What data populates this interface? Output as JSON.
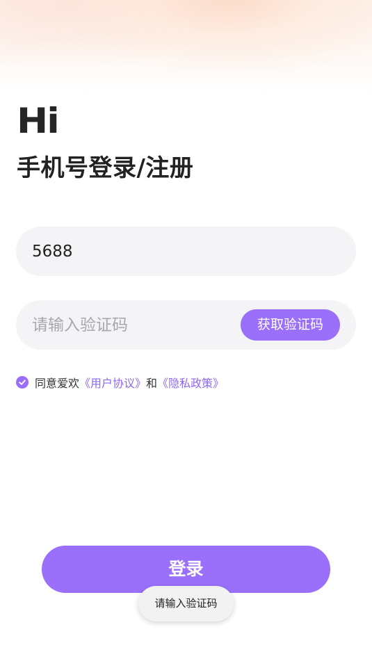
{
  "header": {
    "greeting": "Hi",
    "title": "手机号登录/注册"
  },
  "phone_field": {
    "value": "5688"
  },
  "code_field": {
    "value": "",
    "placeholder": "请输入验证码",
    "get_code_label": "获取验证码"
  },
  "agreement": {
    "checked": true,
    "prefix": "同意爱欢",
    "user_agreement": "《用户协议》",
    "connector": "和",
    "privacy_policy": "《隐私政策》"
  },
  "login_button": {
    "label": "登录"
  },
  "toast": {
    "message": "请输入验证码"
  },
  "colors": {
    "accent": "#9a70fb",
    "link": "#8d66f2",
    "field_background": "#f4f4f6"
  }
}
